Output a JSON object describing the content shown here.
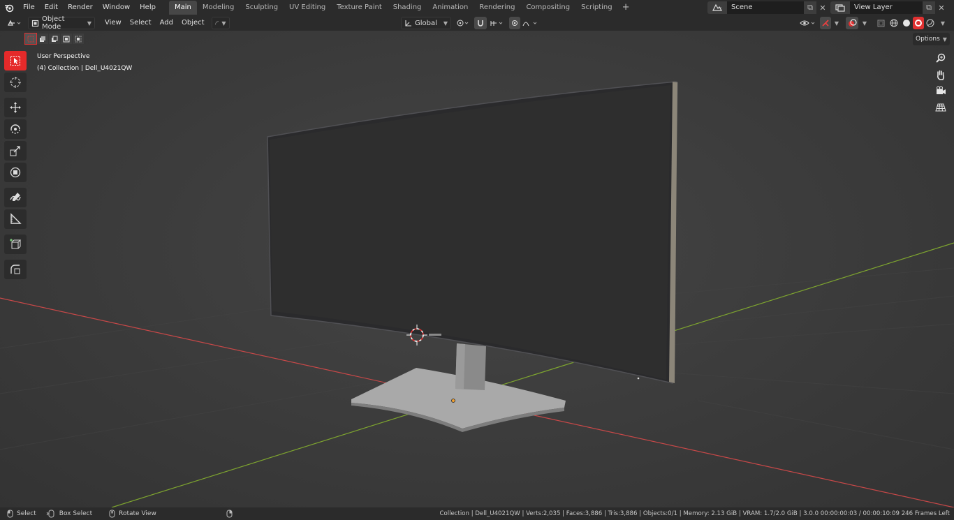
{
  "menubar": {
    "items": [
      "File",
      "Edit",
      "Render",
      "Window",
      "Help"
    ]
  },
  "workspaces": {
    "tabs": [
      "Main",
      "Modeling",
      "Sculpting",
      "UV Editing",
      "Texture Paint",
      "Shading",
      "Animation",
      "Rendering",
      "Compositing",
      "Scripting"
    ],
    "active": "Main",
    "add_label": "+"
  },
  "scene": {
    "name": "Scene",
    "view_layer": "View Layer"
  },
  "header": {
    "mode": "Object Mode",
    "menus": [
      "View",
      "Select",
      "Add",
      "Object"
    ],
    "transform_orientation": "Global"
  },
  "viewport": {
    "perspective_label": "User Perspective",
    "collection_label": "(4) Collection | Dell_U4021QW",
    "options_label": "Options",
    "colors": {
      "x_axis": "#c84848",
      "y_axis": "#7ea52f",
      "active_tool": "#e52a2a",
      "origin": "#f0a030"
    }
  },
  "toolbar": {
    "tools": [
      "select-box-icon",
      "cursor-icon",
      "move-icon",
      "rotate-icon",
      "scale-icon",
      "transform-icon",
      "annotate-icon",
      "measure-icon",
      "add-cube-icon",
      "extrude-icon"
    ]
  },
  "statusbar": {
    "select_label": "Select",
    "box_select_label": "Box Select",
    "rotate_view_label": "Rotate View",
    "stats": "Collection | Dell_U4021QW | Verts:2,035 | Faces:3,886 | Tris:3,886 | Objects:0/1 | Memory: 2.13 GiB | VRAM: 1.7/2.0 GiB | 3.0.0   00:00:00:03 / 00:00:10:09  246 Frames Left"
  }
}
